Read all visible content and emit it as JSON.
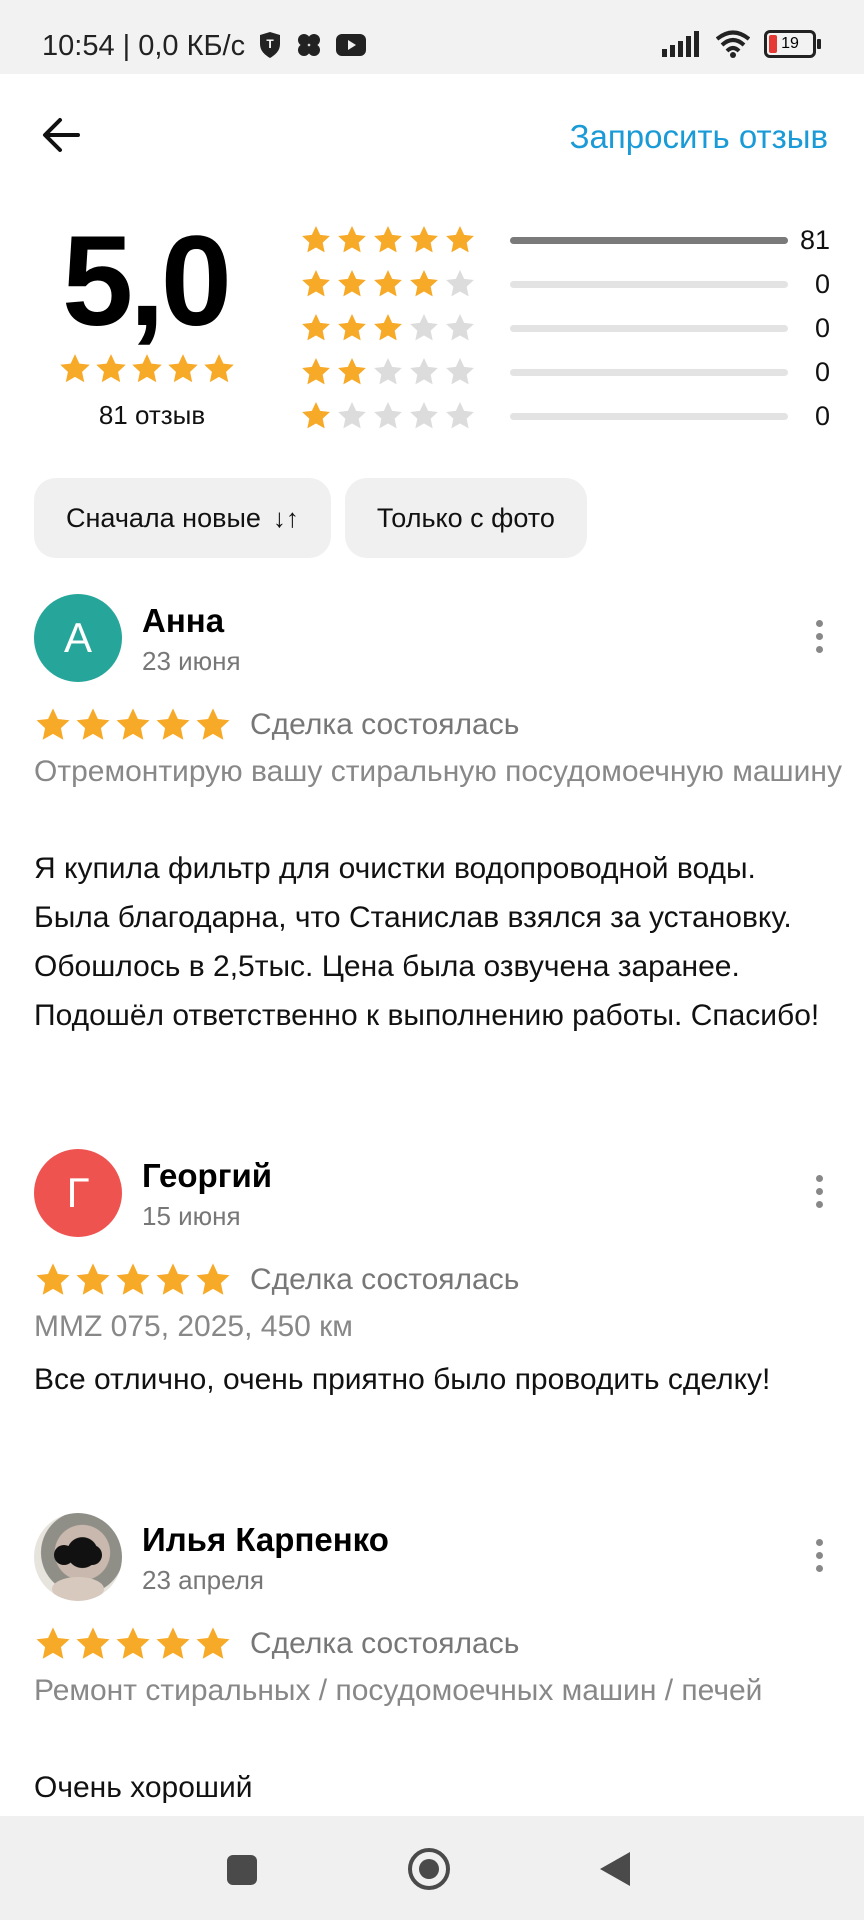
{
  "status_bar": {
    "time": "10:54 | 0,0 КБ/с",
    "battery": "19"
  },
  "header": {
    "request_review": "Запросить отзыв"
  },
  "summary": {
    "rating": "5,0",
    "total": "81 отзыв",
    "distribution": [
      {
        "stars": 5,
        "count": "81",
        "fraction": 1.0
      },
      {
        "stars": 4,
        "count": "0",
        "fraction": 0
      },
      {
        "stars": 3,
        "count": "0",
        "fraction": 0
      },
      {
        "stars": 2,
        "count": "0",
        "fraction": 0
      },
      {
        "stars": 1,
        "count": "0",
        "fraction": 0
      }
    ]
  },
  "filters": {
    "sort": "Сначала новые",
    "photo": "Только с фото"
  },
  "reviews": [
    {
      "initial": "А",
      "avatar_color": "#26a69a",
      "name": "Анна",
      "date": "23 июня",
      "rating": 5,
      "status": "Сделка состоялась",
      "subject": "Отремонтирую вашу стиральную посудомоечную машину",
      "text": "Я купила фильтр для очистки водопроводной воды. Была благодарна, что Станислав взялся за установку. Обошлось в  2,5тыс. Цена была озвучена заранее. Подошёл ответственно к выполнению работы. Спасибо!"
    },
    {
      "initial": "Г",
      "avatar_color": "#ef5350",
      "name": "Георгий",
      "date": "15 июня",
      "rating": 5,
      "status": "Сделка состоялась",
      "subject": "MMZ 075, 2025, 450 км",
      "text": "Все отлично, очень приятно было проводить сделку!"
    },
    {
      "initial": "",
      "avatar_color": "#8a8a8a",
      "name": "Илья Карпенко",
      "date": "23 апреля",
      "rating": 5,
      "status": "Сделка состоялась",
      "subject": "Ремонт стиральных / посудомоечных машин / печей",
      "text": "Очень хороший"
    }
  ],
  "colors": {
    "star": "#f7a928",
    "star_empty": "#dcdcdc",
    "link": "#1a9bd7"
  }
}
